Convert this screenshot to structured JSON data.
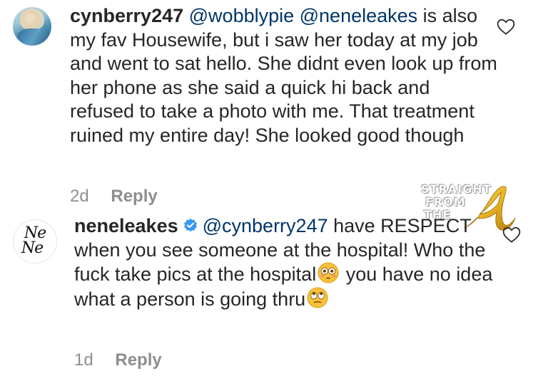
{
  "comments": [
    {
      "username": "cynberry247",
      "mentions": "@wobblypie @neneleakes",
      "body_after_mentions": " is also my fav Housewife, but i saw her today at my job and went to sat hello. She didnt even look up from her phone as she said a quick hi back and refused to take a photo with me. That treatment ruined my entire day! She looked good though",
      "time": "2d",
      "reply_label": "Reply",
      "liked": false
    },
    {
      "username": "neneleakes",
      "verified": true,
      "mention": "@cynberry247",
      "body_part1": " have RESPECT when you see someone at the hospital! Who the fuck take pics at the hospital",
      "body_part2": "  you have no idea what a person is going thru",
      "emoji1": "flushed-face",
      "emoji2": "rolling-eyes-face",
      "avatar_monogram_top": "Ne",
      "avatar_monogram_bottom": "Ne",
      "time": "1d",
      "reply_label": "Reply",
      "liked": false
    }
  ],
  "watermark": {
    "line1": "STRAIGHT",
    "line2": "FROM",
    "line3": "THE",
    "mark": "A"
  },
  "colors": {
    "text": "#262626",
    "meta": "#8e8e8e",
    "mention": "#003569",
    "verified": "#3897f0",
    "watermark_gold": "#e8b321"
  }
}
